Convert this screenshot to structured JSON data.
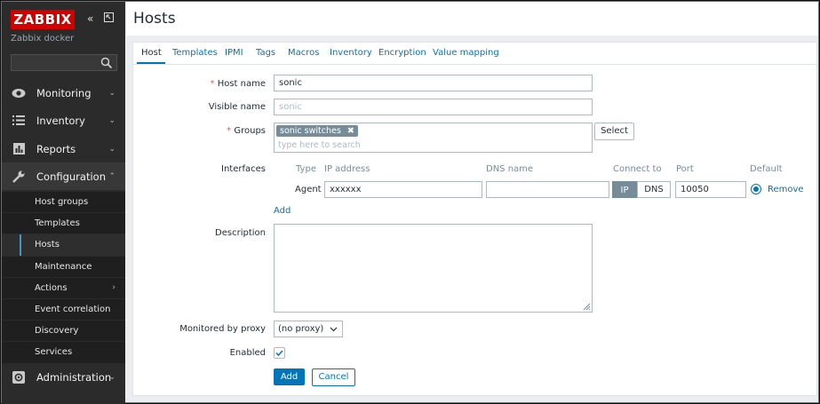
{
  "brand": {
    "logo": "ZABBIX",
    "server_name": "Zabbix docker"
  },
  "sidebar": {
    "menu": [
      {
        "label": "Monitoring",
        "icon": "eye-icon"
      },
      {
        "label": "Inventory",
        "icon": "list-icon"
      },
      {
        "label": "Reports",
        "icon": "bar-chart-icon"
      },
      {
        "label": "Configuration",
        "icon": "wrench-icon"
      },
      {
        "label": "Administration",
        "icon": "gear-icon"
      }
    ],
    "submenu": [
      "Host groups",
      "Templates",
      "Hosts",
      "Maintenance",
      "Actions",
      "Event correlation",
      "Discovery",
      "Services"
    ],
    "selected": "Hosts"
  },
  "header": {
    "title": "Hosts"
  },
  "tabs": [
    "Host",
    "Templates",
    "IPMI",
    "Tags",
    "Macros",
    "Inventory",
    "Encryption",
    "Value mapping"
  ],
  "form": {
    "host_name_label": "Host name",
    "host_name_value": "sonic",
    "visible_name_label": "Visible name",
    "visible_name_placeholder": "sonic",
    "groups_label": "Groups",
    "group_tag": "sonic switches",
    "groups_placeholder": "type here to search",
    "select_label": "Select",
    "interfaces_label": "Interfaces",
    "interface_headers": {
      "type": "Type",
      "ip": "IP address",
      "dns": "DNS name",
      "connect": "Connect to",
      "port": "Port",
      "default": "Default"
    },
    "interface_row": {
      "type": "Agent",
      "ip": "xxxxxx",
      "dns": "",
      "connect_ip": "IP",
      "connect_dns": "DNS",
      "port": "10050",
      "remove": "Remove"
    },
    "add_interface_label": "Add",
    "description_label": "Description",
    "proxy_label": "Monitored by proxy",
    "proxy_value": "(no proxy)",
    "enabled_label": "Enabled",
    "add_button": "Add",
    "cancel_button": "Cancel"
  },
  "colors": {
    "accent": "#0275b8",
    "brand": "#d40000",
    "sidebar": "#2b2b2b",
    "required": "#e45959"
  }
}
